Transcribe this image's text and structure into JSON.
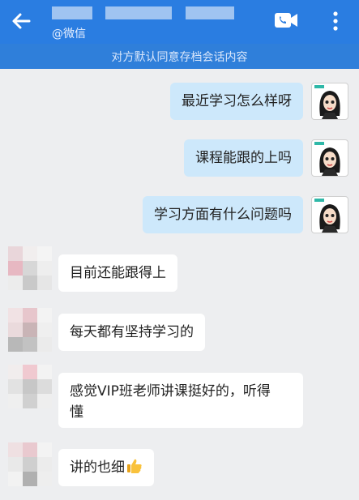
{
  "header": {
    "subtitle": "@微信",
    "back": "back",
    "video_call": "video-call",
    "more": "more"
  },
  "notice": "对方默认同意存档会话内容",
  "messages": [
    {
      "sender": "me",
      "text": "最近学习怎么样呀"
    },
    {
      "sender": "me",
      "text": "课程能跟的上吗"
    },
    {
      "sender": "me",
      "text": "学习方面有什么问题吗"
    },
    {
      "sender": "contact",
      "text": "目前还能跟得上"
    },
    {
      "sender": "contact",
      "text": "每天都有坚持学习的"
    },
    {
      "sender": "contact",
      "line1": "感觉VIP班老师讲课挺好的，听得",
      "line2": "懂"
    },
    {
      "sender": "contact",
      "text": "讲的也细",
      "emoji": "thumbs-up-emoji"
    }
  ],
  "colors": {
    "header": "#2a7de1",
    "my_bubble": "#cde8fb",
    "their_bubble": "#ffffff",
    "background": "#edeef0"
  }
}
